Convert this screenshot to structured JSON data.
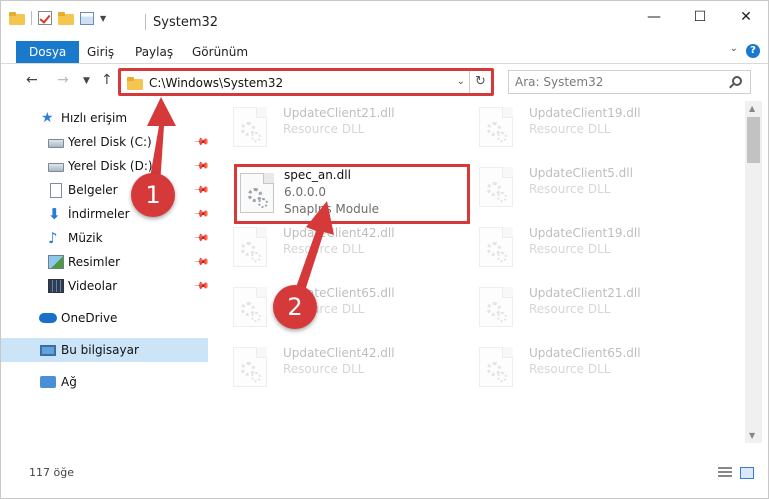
{
  "window": {
    "title": "System32",
    "controls": {
      "minimize": "—",
      "maximize": "☐",
      "close": "✕"
    }
  },
  "ribbon": {
    "tabs": [
      "Dosya",
      "Giriş",
      "Paylaş",
      "Görünüm"
    ],
    "file_tab_color": "#1979ca"
  },
  "address": {
    "path": "C:\\Windows\\System32",
    "search_placeholder": "Ara: System32",
    "highlight_color": "#d5393a"
  },
  "sidebar": {
    "quick_access": "Hızlı erişim",
    "items": [
      {
        "label": "Yerel Disk (C:)",
        "icon": "disk-icon",
        "pinned": true
      },
      {
        "label": "Yerel Disk (D:)",
        "icon": "disk-icon",
        "pinned": true
      },
      {
        "label": "Belgeler",
        "icon": "documents-icon",
        "pinned": true
      },
      {
        "label": "İndirmeler",
        "icon": "downloads-icon",
        "pinned": true
      },
      {
        "label": "Müzik",
        "icon": "music-icon",
        "pinned": true
      },
      {
        "label": "Resimler",
        "icon": "pictures-icon",
        "pinned": true
      },
      {
        "label": "Videolar",
        "icon": "videos-icon",
        "pinned": true
      }
    ],
    "onedrive": "OneDrive",
    "this_pc": "Bu bilgisayar",
    "network": "Ağ"
  },
  "files": {
    "highlighted": {
      "name": "spec_an.dll",
      "version": "6.0.0.0",
      "description": "SnapIns Module"
    },
    "faded": [
      {
        "name": "UpdateClient21.dll",
        "description": "Resource DLL"
      },
      {
        "name": "UpdateClient19.dll",
        "description": "Resource DLL"
      },
      {
        "name": "UpdateClient5.dll",
        "description": "Resource DLL"
      },
      {
        "name": "UpdateClient42.dll",
        "description": "Resource DLL"
      },
      {
        "name": "UpdateClient19.dll",
        "description": "Resource DLL"
      },
      {
        "name": "UpdateClient65.dll",
        "description": "Resource DLL"
      },
      {
        "name": "UpdateClient21.dll",
        "description": "Resource DLL"
      },
      {
        "name": "UpdateClient42.dll",
        "description": "Resource DLL"
      },
      {
        "name": "UpdateClient65.dll",
        "description": "Resource DLL"
      }
    ]
  },
  "status": {
    "item_count": "117 öğe"
  },
  "annotations": {
    "step1": "1",
    "step2": "2",
    "color": "#d5393a"
  }
}
